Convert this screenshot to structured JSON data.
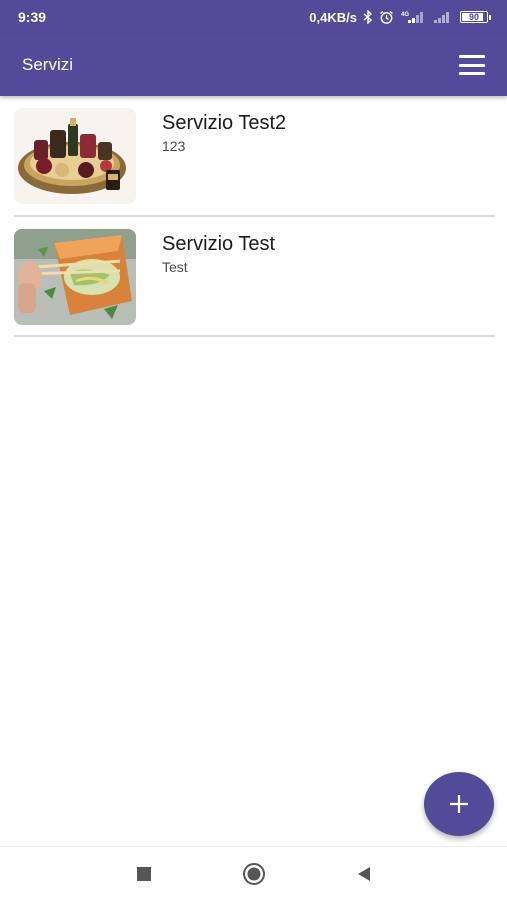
{
  "status_bar": {
    "time": "9:39",
    "network_speed": "0,4KB/s",
    "network_type": "4G",
    "battery_level": "90",
    "battery_percent": 90,
    "icons": [
      "bluetooth-icon",
      "alarm-icon",
      "signal-4g-icon",
      "signal-icon",
      "battery-icon"
    ]
  },
  "app_bar": {
    "title": "Servizi",
    "menu_icon": "hamburger-menu-icon"
  },
  "services": [
    {
      "title": "Servizio Test2",
      "subtitle": "123",
      "image": "gift-basket-photo"
    },
    {
      "title": "Servizio Test",
      "subtitle": "Test",
      "image": "food-box-chopsticks-photo"
    }
  ],
  "fab": {
    "icon": "plus-icon"
  },
  "nav_bar": {
    "icons": [
      "recents-square-icon",
      "home-circle-icon",
      "back-triangle-icon"
    ]
  },
  "colors": {
    "primary": "#544a9a",
    "divider": "#dcdcdc",
    "title_text": "#1c1c1c",
    "subtitle_text": "#4a4a4a"
  }
}
